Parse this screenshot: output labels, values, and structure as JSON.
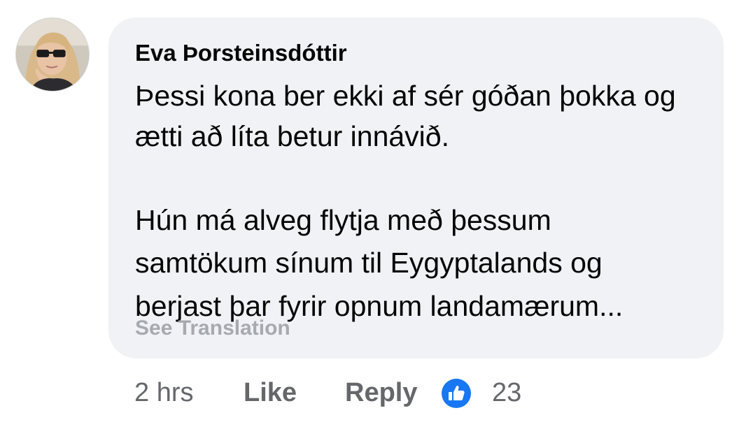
{
  "comment": {
    "author": "Eva Þorsteinsdóttir",
    "lines": [
      "Þessi kona ber ekki af sér góðan þokka og",
      "ætti að líta betur innávið.",
      "Hún má alveg flytja með þessum",
      "samtökum sínum til Eygyptalands og",
      "berjast þar fyrir opnum landamærum..."
    ],
    "see_translation": "See Translation"
  },
  "actions": {
    "time": "2 hrs",
    "like_label": "Like",
    "reply_label": "Reply",
    "reaction_icon": "thumbs-up-icon",
    "reaction_count": "23"
  },
  "colors": {
    "bubble_bg": "#f0f2f5",
    "text": "#050505",
    "secondary": "#65676b",
    "like_blue": "#1877f2"
  }
}
